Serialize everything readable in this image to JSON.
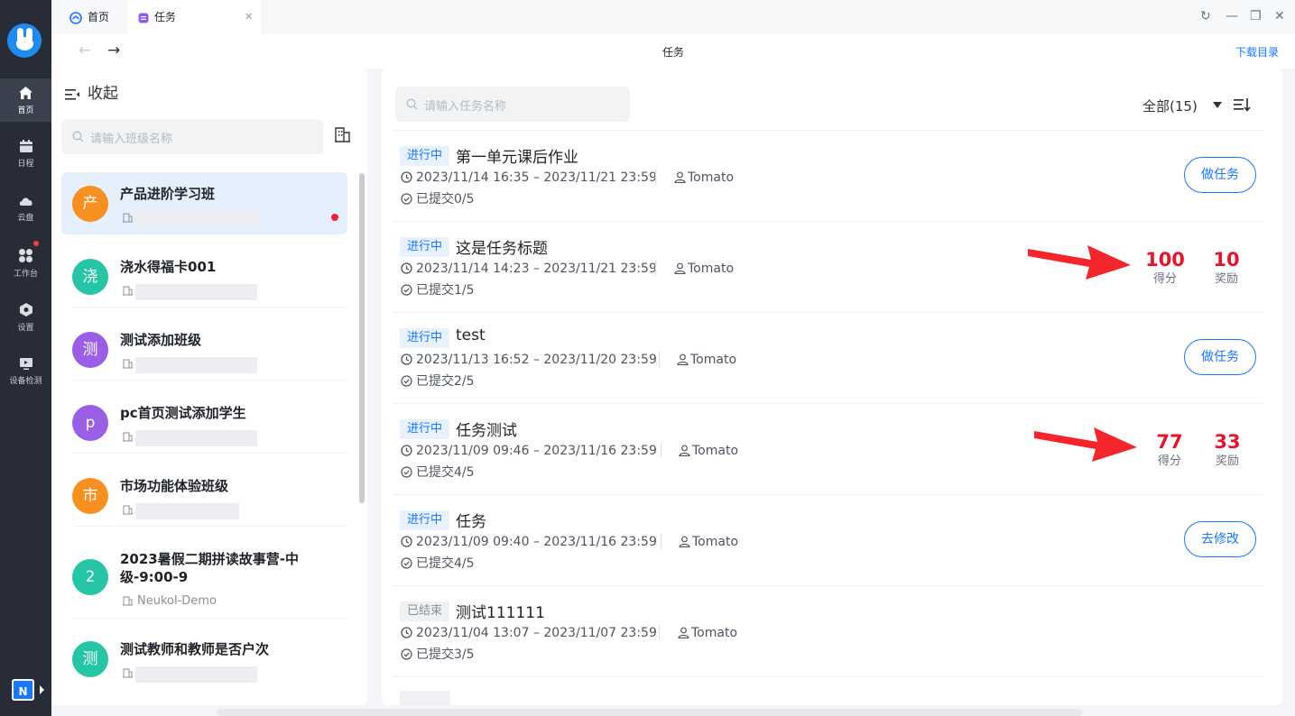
{
  "tabs": [
    {
      "label": "首页",
      "icon": "school-icon"
    },
    {
      "label": "任务",
      "icon": "task-icon"
    }
  ],
  "toolbar": {
    "title": "任务",
    "download": "下载目录"
  },
  "sidebar": [
    {
      "label": "首页",
      "icon": "home-icon"
    },
    {
      "label": "日程",
      "icon": "calendar-icon"
    },
    {
      "label": "云盘",
      "icon": "cloud-icon"
    },
    {
      "label": "工作台",
      "icon": "apps-icon"
    },
    {
      "label": "设置",
      "icon": "settings-icon"
    },
    {
      "label": "设备检测",
      "icon": "device-icon"
    }
  ],
  "app_badge": "N",
  "left": {
    "collapse": "收起",
    "search_placeholder": "请输入班级名称",
    "classes": [
      {
        "avatar": "产",
        "name": "产品进阶学习班",
        "org": "",
        "color": "#f7901e"
      },
      {
        "avatar": "浇",
        "name": "浇水得福卡001",
        "org": "",
        "color": "#25c5a6"
      },
      {
        "avatar": "测",
        "name": "测试添加班级",
        "org": "",
        "color": "#9b5ee6"
      },
      {
        "avatar": "p",
        "name": "pc首页测试添加学生",
        "org": "",
        "color": "#9b5ee6"
      },
      {
        "avatar": "市",
        "name": "市场功能体验班级",
        "org": "",
        "color": "#f7901e"
      },
      {
        "avatar": "2",
        "name": "2023暑假二期拼读故事营-中级-9:00-9",
        "org": "Neukol-Demo",
        "color": "#25c5a6"
      },
      {
        "avatar": "测",
        "name": "测试教师和教师是否户次",
        "org": "",
        "color": "#25c5a6"
      }
    ]
  },
  "right": {
    "search_placeholder": "请输入任务名称",
    "filter": "全部(15)",
    "tasks": [
      {
        "status": "进行中",
        "title": "第一单元课后作业",
        "time": "2023/11/14 16:35 – 2023/11/21 23:59",
        "owner": "Tomato",
        "submitted": "已提交0/5",
        "button": "做任务"
      },
      {
        "status": "进行中",
        "title": "这是任务标题",
        "time": "2023/11/14 14:23 – 2023/11/21 23:59",
        "owner": "Tomato",
        "submitted": "已提交1/5",
        "score": "100",
        "score_label": "得分",
        "reward": "10",
        "reward_label": "奖励"
      },
      {
        "status": "进行中",
        "title": "test",
        "time": "2023/11/13 16:52 – 2023/11/20 23:59",
        "owner": "Tomato",
        "submitted": "已提交2/5",
        "button": "做任务"
      },
      {
        "status": "进行中",
        "title": "任务测试",
        "time": "2023/11/09 09:46 – 2023/11/16 23:59",
        "owner": "Tomato",
        "submitted": "已提交4/5",
        "score": "77",
        "score_label": "得分",
        "reward": "33",
        "reward_label": "奖励"
      },
      {
        "status": "进行中",
        "title": "任务",
        "time": "2023/11/09 09:40 – 2023/11/16 23:59",
        "owner": "Tomato",
        "submitted": "已提交4/5",
        "button": "去修改"
      },
      {
        "status": "已结束",
        "title": "测试111111",
        "time": "2023/11/04 13:07 – 2023/11/07 23:59",
        "owner": "Tomato",
        "submitted": "已提交3/5"
      }
    ]
  }
}
